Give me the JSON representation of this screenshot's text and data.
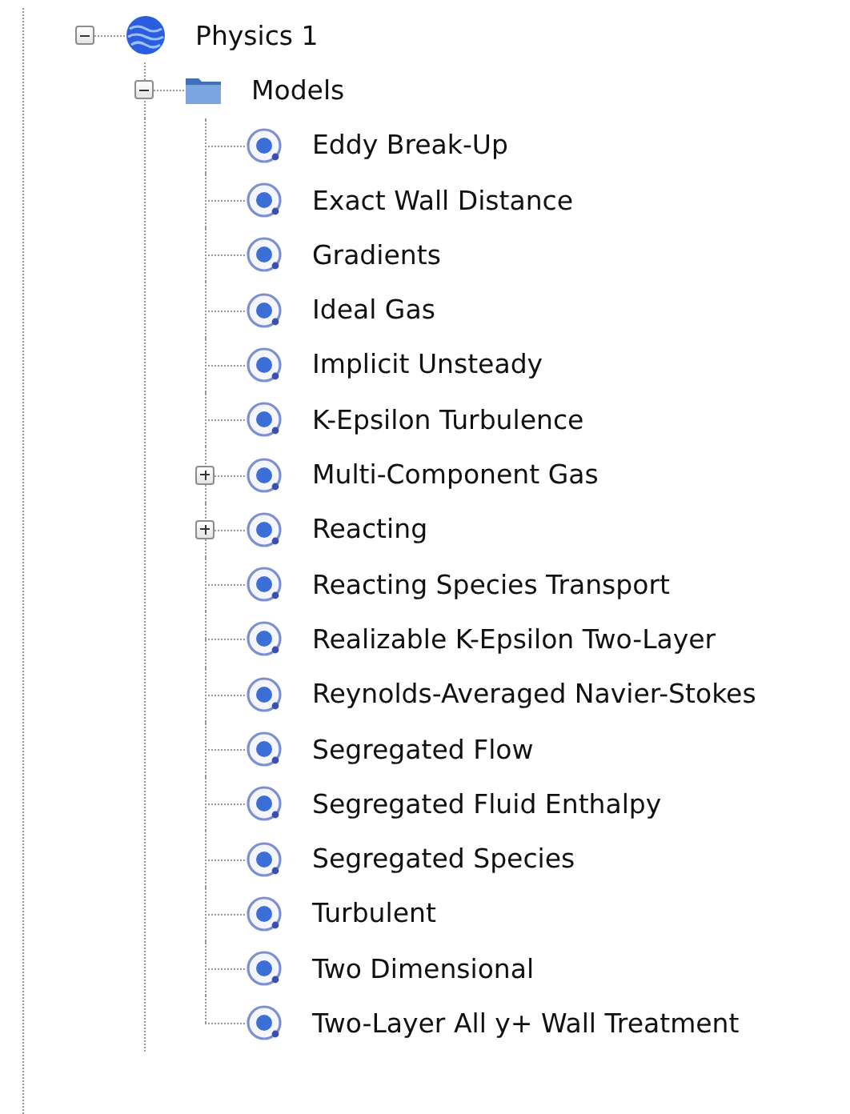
{
  "tree": [
    {
      "label": "Physics 1",
      "kind": "physics",
      "expanded": true,
      "children": [
        {
          "label": "Models",
          "kind": "folder",
          "expanded": true,
          "children": [
            {
              "label": "Eddy Break-Up",
              "kind": "model"
            },
            {
              "label": "Exact Wall Distance",
              "kind": "model"
            },
            {
              "label": "Gradients",
              "kind": "model"
            },
            {
              "label": "Ideal Gas",
              "kind": "model"
            },
            {
              "label": "Implicit Unsteady",
              "kind": "model"
            },
            {
              "label": "K-Epsilon Turbulence",
              "kind": "model"
            },
            {
              "label": "Multi-Component Gas",
              "kind": "model",
              "expanded": false
            },
            {
              "label": "Reacting",
              "kind": "model",
              "expanded": false
            },
            {
              "label": "Reacting Species Transport",
              "kind": "model"
            },
            {
              "label": "Realizable K-Epsilon Two-Layer",
              "kind": "model"
            },
            {
              "label": "Reynolds-Averaged Navier-Stokes",
              "kind": "model"
            },
            {
              "label": "Segregated Flow",
              "kind": "model"
            },
            {
              "label": "Segregated Fluid Enthalpy",
              "kind": "model"
            },
            {
              "label": "Segregated Species",
              "kind": "model"
            },
            {
              "label": "Turbulent",
              "kind": "model"
            },
            {
              "label": "Two Dimensional",
              "kind": "model"
            },
            {
              "label": "Two-Layer All y+ Wall Treatment",
              "kind": "model"
            }
          ]
        }
      ]
    }
  ]
}
